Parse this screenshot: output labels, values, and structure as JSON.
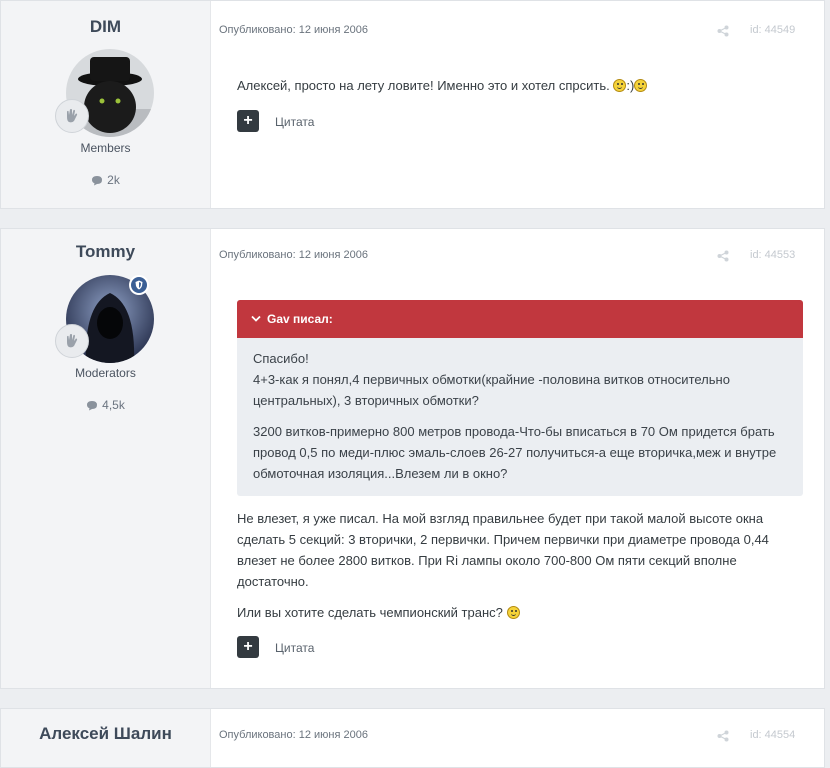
{
  "posts": [
    {
      "author": "DIM",
      "group": "Members",
      "post_count": "2k",
      "published": "Опубликовано: 12 июня 2006",
      "post_id": "id: 44549",
      "text": "Алексей, просто на лету ловите! Именно это и хотел спрсить. ",
      "text_tail": ":)",
      "quote_label": "Цитата"
    },
    {
      "author": "Tommy",
      "group": "Moderators",
      "post_count": "4,5k",
      "published": "Опубликовано: 12 июня 2006",
      "post_id": "id: 44553",
      "quote": {
        "header": "Gav писал:",
        "p1_l1": "Спасибо!",
        "p1_l2": "4+3-как я понял,4 первичных обмотки(крайние -половина витков относительно центральных), 3 вторичных обмотки?",
        "p2": "3200 витков-примерно 800 метров провода-Что-бы вписаться в 70 Ом придется брать провод 0,5 по меди-плюс эмаль-слоев 26-27 получиться-а еще вторичка,меж и внутре обмоточная изоляция...Влезем ли в окно?"
      },
      "reply_p1": "Не влезет, я уже писал. На мой взгляд правильнее будет при такой малой высоте окна сделать 5 секций: 3 вторички, 2 первички. Причем первички при диаметре провода 0,44 влезет не более 2800 витков. При Ri лампы около 700-800 Ом пяти секций вполне достаточно.",
      "reply_p2": "Или вы хотите сделать чемпионский транс? ",
      "quote_label": "Цитата"
    },
    {
      "author": "Алексей Шалин",
      "published": "Опубликовано: 12 июня 2006",
      "post_id": "id: 44554"
    }
  ]
}
